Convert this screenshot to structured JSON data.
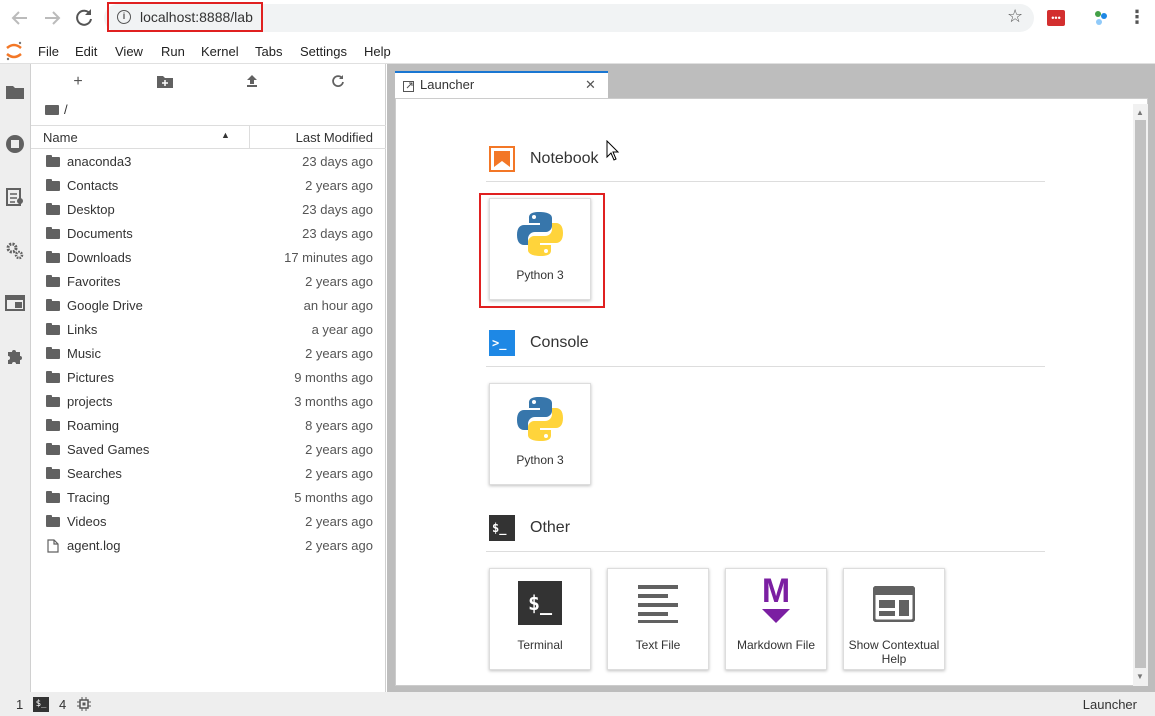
{
  "browser": {
    "url": "localhost:8888/lab",
    "back_icon": "arrow-left",
    "forward_icon": "arrow-right",
    "reload_icon": "reload",
    "info_icon": "i",
    "star_icon": "☆",
    "menu_icon": "⋮"
  },
  "menu": {
    "items": [
      "File",
      "Edit",
      "View",
      "Run",
      "Kernel",
      "Tabs",
      "Settings",
      "Help"
    ]
  },
  "file_browser": {
    "breadcrumb": "/",
    "columns": {
      "name": "Name",
      "modified": "Last Modified"
    },
    "sort_indicator": "▲",
    "files": [
      {
        "name": "anaconda3",
        "modified": "23 days ago",
        "type": "folder"
      },
      {
        "name": "Contacts",
        "modified": "2 years ago",
        "type": "folder"
      },
      {
        "name": "Desktop",
        "modified": "23 days ago",
        "type": "folder"
      },
      {
        "name": "Documents",
        "modified": "23 days ago",
        "type": "folder"
      },
      {
        "name": "Downloads",
        "modified": "17 minutes ago",
        "type": "folder"
      },
      {
        "name": "Favorites",
        "modified": "2 years ago",
        "type": "folder"
      },
      {
        "name": "Google Drive",
        "modified": "an hour ago",
        "type": "folder"
      },
      {
        "name": "Links",
        "modified": "a year ago",
        "type": "folder"
      },
      {
        "name": "Music",
        "modified": "2 years ago",
        "type": "folder"
      },
      {
        "name": "Pictures",
        "modified": "9 months ago",
        "type": "folder"
      },
      {
        "name": "projects",
        "modified": "3 months ago",
        "type": "folder"
      },
      {
        "name": "Roaming",
        "modified": "8 years ago",
        "type": "folder"
      },
      {
        "name": "Saved Games",
        "modified": "2 years ago",
        "type": "folder"
      },
      {
        "name": "Searches",
        "modified": "2 years ago",
        "type": "folder"
      },
      {
        "name": "Tracing",
        "modified": "5 months ago",
        "type": "folder"
      },
      {
        "name": "Videos",
        "modified": "2 years ago",
        "type": "folder"
      },
      {
        "name": "agent.log",
        "modified": "2 years ago",
        "type": "file"
      }
    ]
  },
  "tab": {
    "label": "Launcher",
    "close": "✕"
  },
  "launcher": {
    "notebook": {
      "title": "Notebook",
      "cards": [
        {
          "label": "Python 3"
        }
      ]
    },
    "console": {
      "title": "Console",
      "cards": [
        {
          "label": "Python 3"
        }
      ]
    },
    "other": {
      "title": "Other",
      "cards": [
        {
          "label": "Terminal"
        },
        {
          "label": "Text File"
        },
        {
          "label": "Markdown File"
        },
        {
          "label": "Show Contextual Help"
        }
      ]
    },
    "console_icon_text": ">_",
    "other_icon_text": "$_",
    "terminal_icon_text": "$_",
    "markdown_icon_text": "M"
  },
  "status": {
    "count_a": "1",
    "terminal_icon_text": "$_",
    "count_b": "4",
    "right_label": "Launcher"
  },
  "colors": {
    "accent": "#1976d2",
    "highlight": "#e02020",
    "notebook_orange": "#f37726",
    "markdown_purple": "#7b1fa2"
  }
}
